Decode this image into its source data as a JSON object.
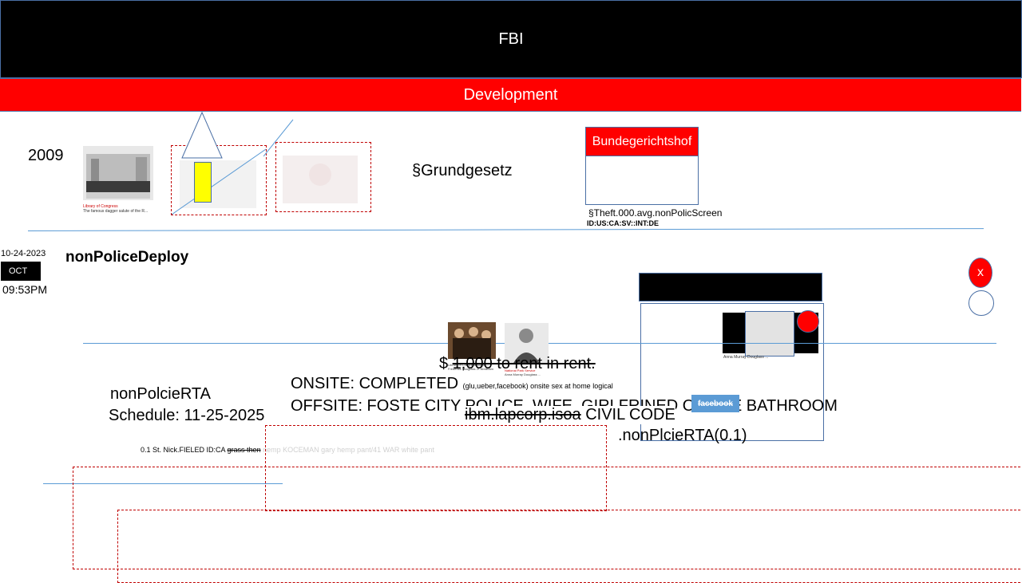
{
  "header": {
    "title": "FBI",
    "subtitle": "Development"
  },
  "row1": {
    "year": "2009",
    "photo1_caption_source": "Library of Congress",
    "photo1_caption": "The famous dagger salute of the R...",
    "grundgesetz": "§Grundgesetz",
    "court_label": "Bundegerichtshof",
    "theft_text": "§Theft.000.avg.nonPolicScreen",
    "id_text": "ID:US:CA:SV::INT:DE"
  },
  "row2": {
    "date": "10-24-2023",
    "month_badge": "OCT",
    "time": "09:53PM",
    "heading": "nonPoliceDeploy",
    "close_label": "x",
    "photo_a_caption": "Library of Congress Blogs — Frederick Douglass Jr. Abraham",
    "photo_b_caption_source": "National Park Service",
    "photo_b_caption": "Anna Murray Douglass ...",
    "card_caption": "Anna Murray Douglass ..."
  },
  "row3": {
    "rent_text": "$ 1,000 to rent in rent.",
    "rent_prefix": "$",
    "rent_struck": "1,000 to rent in rent.",
    "rta_label": "nonPolcieRTA",
    "schedule": "Schedule: 11-25-2025",
    "onsite": "ONSITE: COMPLETED",
    "onsite_note": "(glu,ueber,facebook) onsite sex at home logical",
    "offsite": "OFFSITE: FOSTE CITY POLICE, WIFE, GIRLFRINED ONSITE BATHROOM",
    "ibm_struck": "ibm.lapcorp.isoa",
    "civil_code": "CIVIL CODE",
    "facebook_badge": "facebook",
    "rta_call": ".nonPlcieRTA(0.1)",
    "footer_prefix": "0.1 St. Nick.FIELED ID:CA",
    "footer_struck": "grass then",
    "footer_faded": "nemp KOCEMAN gary hemp pant/41 WAR white pant"
  },
  "colors": {
    "bar_black": "#000000",
    "bar_red": "#ff0000",
    "accent_blue": "#5b9bd5",
    "dash_red": "#c00000",
    "yellow": "#ffff00"
  },
  "icons": {
    "triangle": "triangle-shape",
    "close": "close-icon",
    "circle": "empty-circle"
  }
}
